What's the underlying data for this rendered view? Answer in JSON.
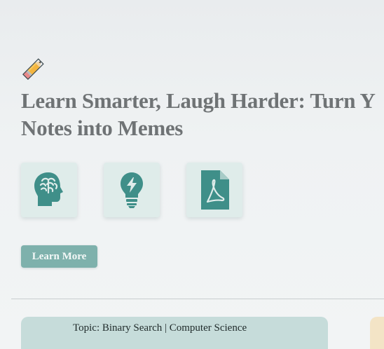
{
  "hero": {
    "title_line1": "Learn Smarter, Laugh Harder: Turn Y",
    "title_line2": "Notes into Memes",
    "icons": {
      "top": "pencil-icon",
      "features": [
        "brain-head-icon",
        "lightbulb-icon",
        "pdf-file-icon"
      ]
    },
    "learn_more_label": "Learn More"
  },
  "topic": {
    "label": "Topic: Binary Search | Computer Science"
  },
  "colors": {
    "accent": "#7eb1ac",
    "icon": "#3f8f89",
    "title": "#6f7375",
    "card_bg": "#dfecea",
    "topic_card_bg": "#c6dcda"
  }
}
